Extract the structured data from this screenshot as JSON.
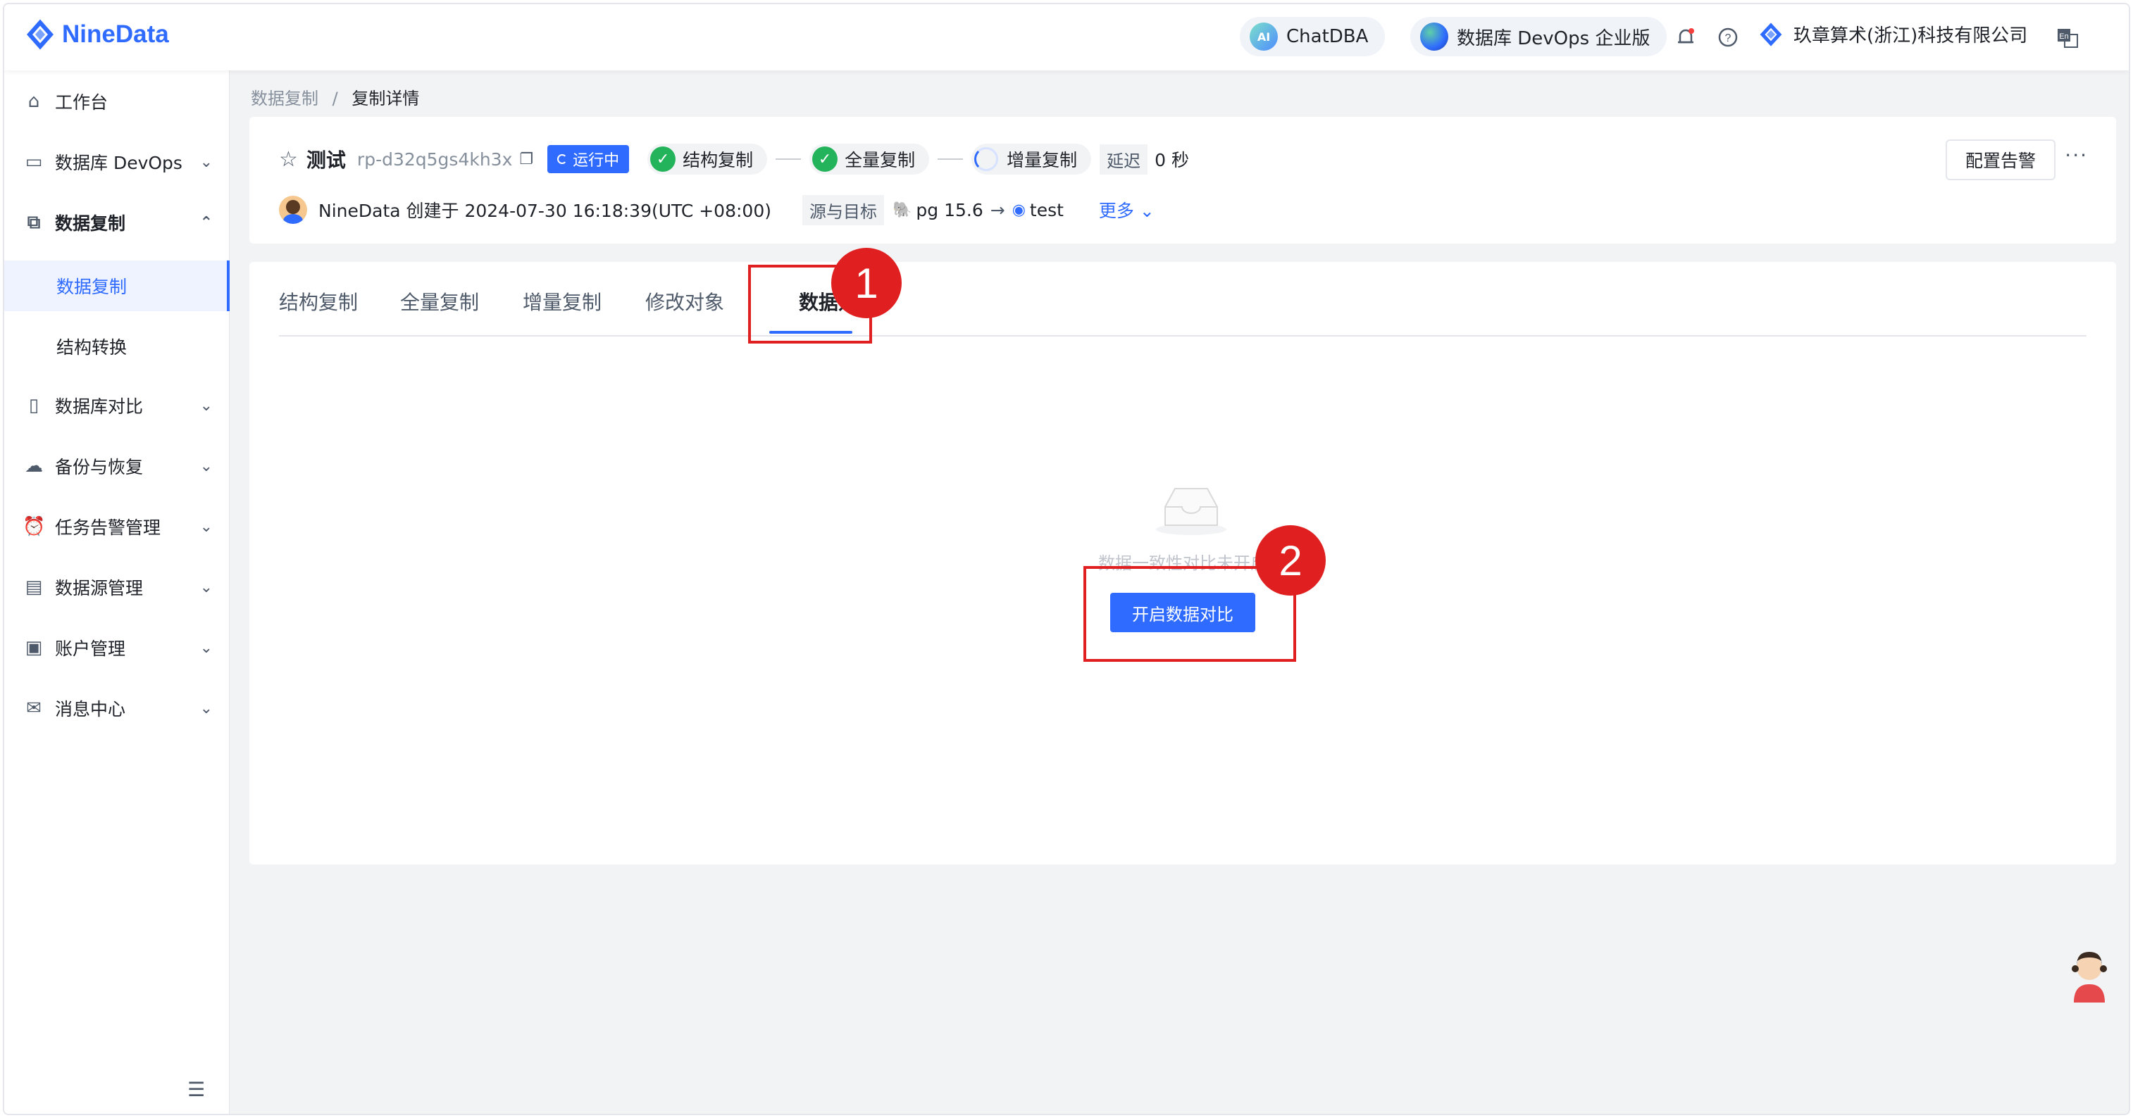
{
  "brand": {
    "name": "NineData",
    "color": "#2f6bff"
  },
  "header": {
    "chatdba_icon_text": "AI",
    "chatdba_label": "ChatDBA",
    "edition_label": "数据库 DevOps 企业版",
    "bell_icon": "bell-icon",
    "help_icon": "help-icon",
    "org_name": "玖章算术(浙江)科技有限公司",
    "lang_icon": "language-icon"
  },
  "sidebar": {
    "items": [
      {
        "label": "工作台",
        "icon": "home-icon"
      },
      {
        "label": "数据库 DevOps",
        "icon": "monitor-icon"
      },
      {
        "label": "数据复制",
        "icon": "replication-icon"
      },
      {
        "label": "数据复制",
        "icon": ""
      },
      {
        "label": "结构转换",
        "icon": ""
      },
      {
        "label": "数据库对比",
        "icon": "compare-icon"
      },
      {
        "label": "备份与恢复",
        "icon": "cloud-icon"
      },
      {
        "label": "任务告警管理",
        "icon": "alarm-icon"
      },
      {
        "label": "数据源管理",
        "icon": "datasource-icon"
      },
      {
        "label": "账户管理",
        "icon": "account-icon"
      },
      {
        "label": "消息中心",
        "icon": "mail-icon"
      }
    ]
  },
  "breadcrumb": {
    "parent": "数据复制",
    "separator": "/",
    "current": "复制详情"
  },
  "task": {
    "name": "测试",
    "id": "rp-d32q5gs4kh3x",
    "status": "运行中",
    "steps": [
      {
        "label": "结构复制",
        "state": "done"
      },
      {
        "label": "全量复制",
        "state": "done"
      },
      {
        "label": "增量复制",
        "state": "running"
      }
    ],
    "delay_label": "延迟",
    "delay_value": "0 秒",
    "creator_line": "NineData 创建于 2024-07-30 16:18:39(UTC +08:00)",
    "source_target_label": "源与目标",
    "source": "pg 15.6",
    "target": "test",
    "more_label": "更多",
    "alarm_button": "配置告警"
  },
  "tabs": [
    {
      "label": "结构复制",
      "active": false
    },
    {
      "label": "全量复制",
      "active": false
    },
    {
      "label": "增量复制",
      "active": false
    },
    {
      "label": "修改对象",
      "active": false
    },
    {
      "label": "数据对比",
      "active": true
    }
  ],
  "empty_state": {
    "text": "数据一致性对比未开启",
    "button": "开启数据对比"
  },
  "annotations": [
    {
      "number": "1",
      "color": "#e02020"
    },
    {
      "number": "2",
      "color": "#e02020"
    }
  ]
}
